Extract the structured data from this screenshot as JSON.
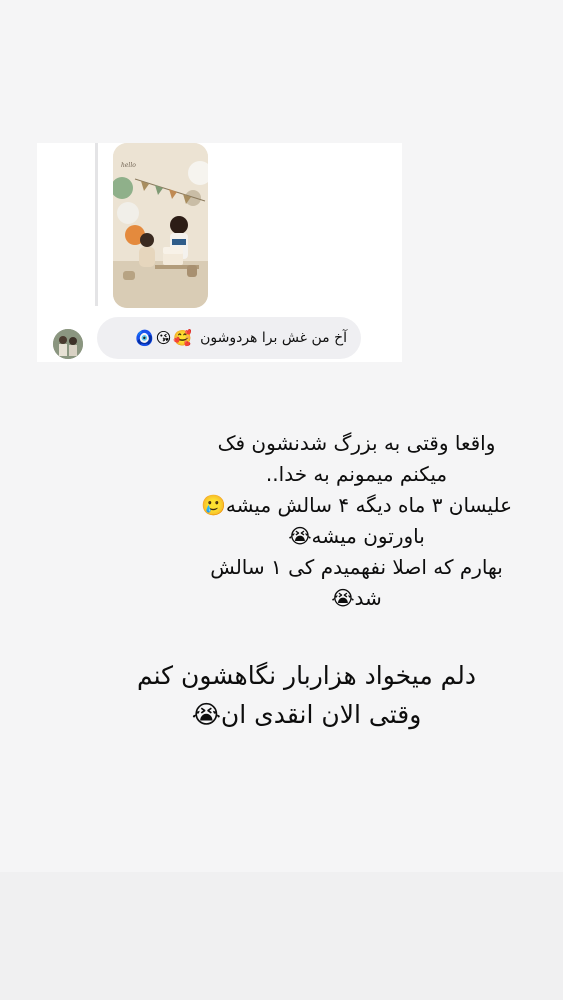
{
  "message": {
    "text": "آخ من غش برا هردوشون",
    "emojis": "🥰😘🧿"
  },
  "story_thumbnail": {
    "sign_text": "hello"
  },
  "captions": [
    "واقعا وقتی به بزرگ شدنشون فک\nمیکنم میمونم به خدا..\nعلیسان ۳ ماه دیگه ۴ سالش میشه🥲\nباورتون میشه😭\nبهارم که اصلا نفهمیدم کی ۱ سالش\nشد😭",
    "دلم میخواد هزاربار نگاهشون کنم\nوقتی الان انقدی ان😭"
  ],
  "colors": {
    "page_background": "#f5f5f6",
    "card_background": "#ffffff",
    "bubble_background": "#efeff2",
    "text": "#0d0d0d"
  },
  "icons": [
    "nazar-emoji",
    "kiss-emoji",
    "heart-face-emoji",
    "loudly-crying-emoji",
    "holding-tears-emoji"
  ]
}
